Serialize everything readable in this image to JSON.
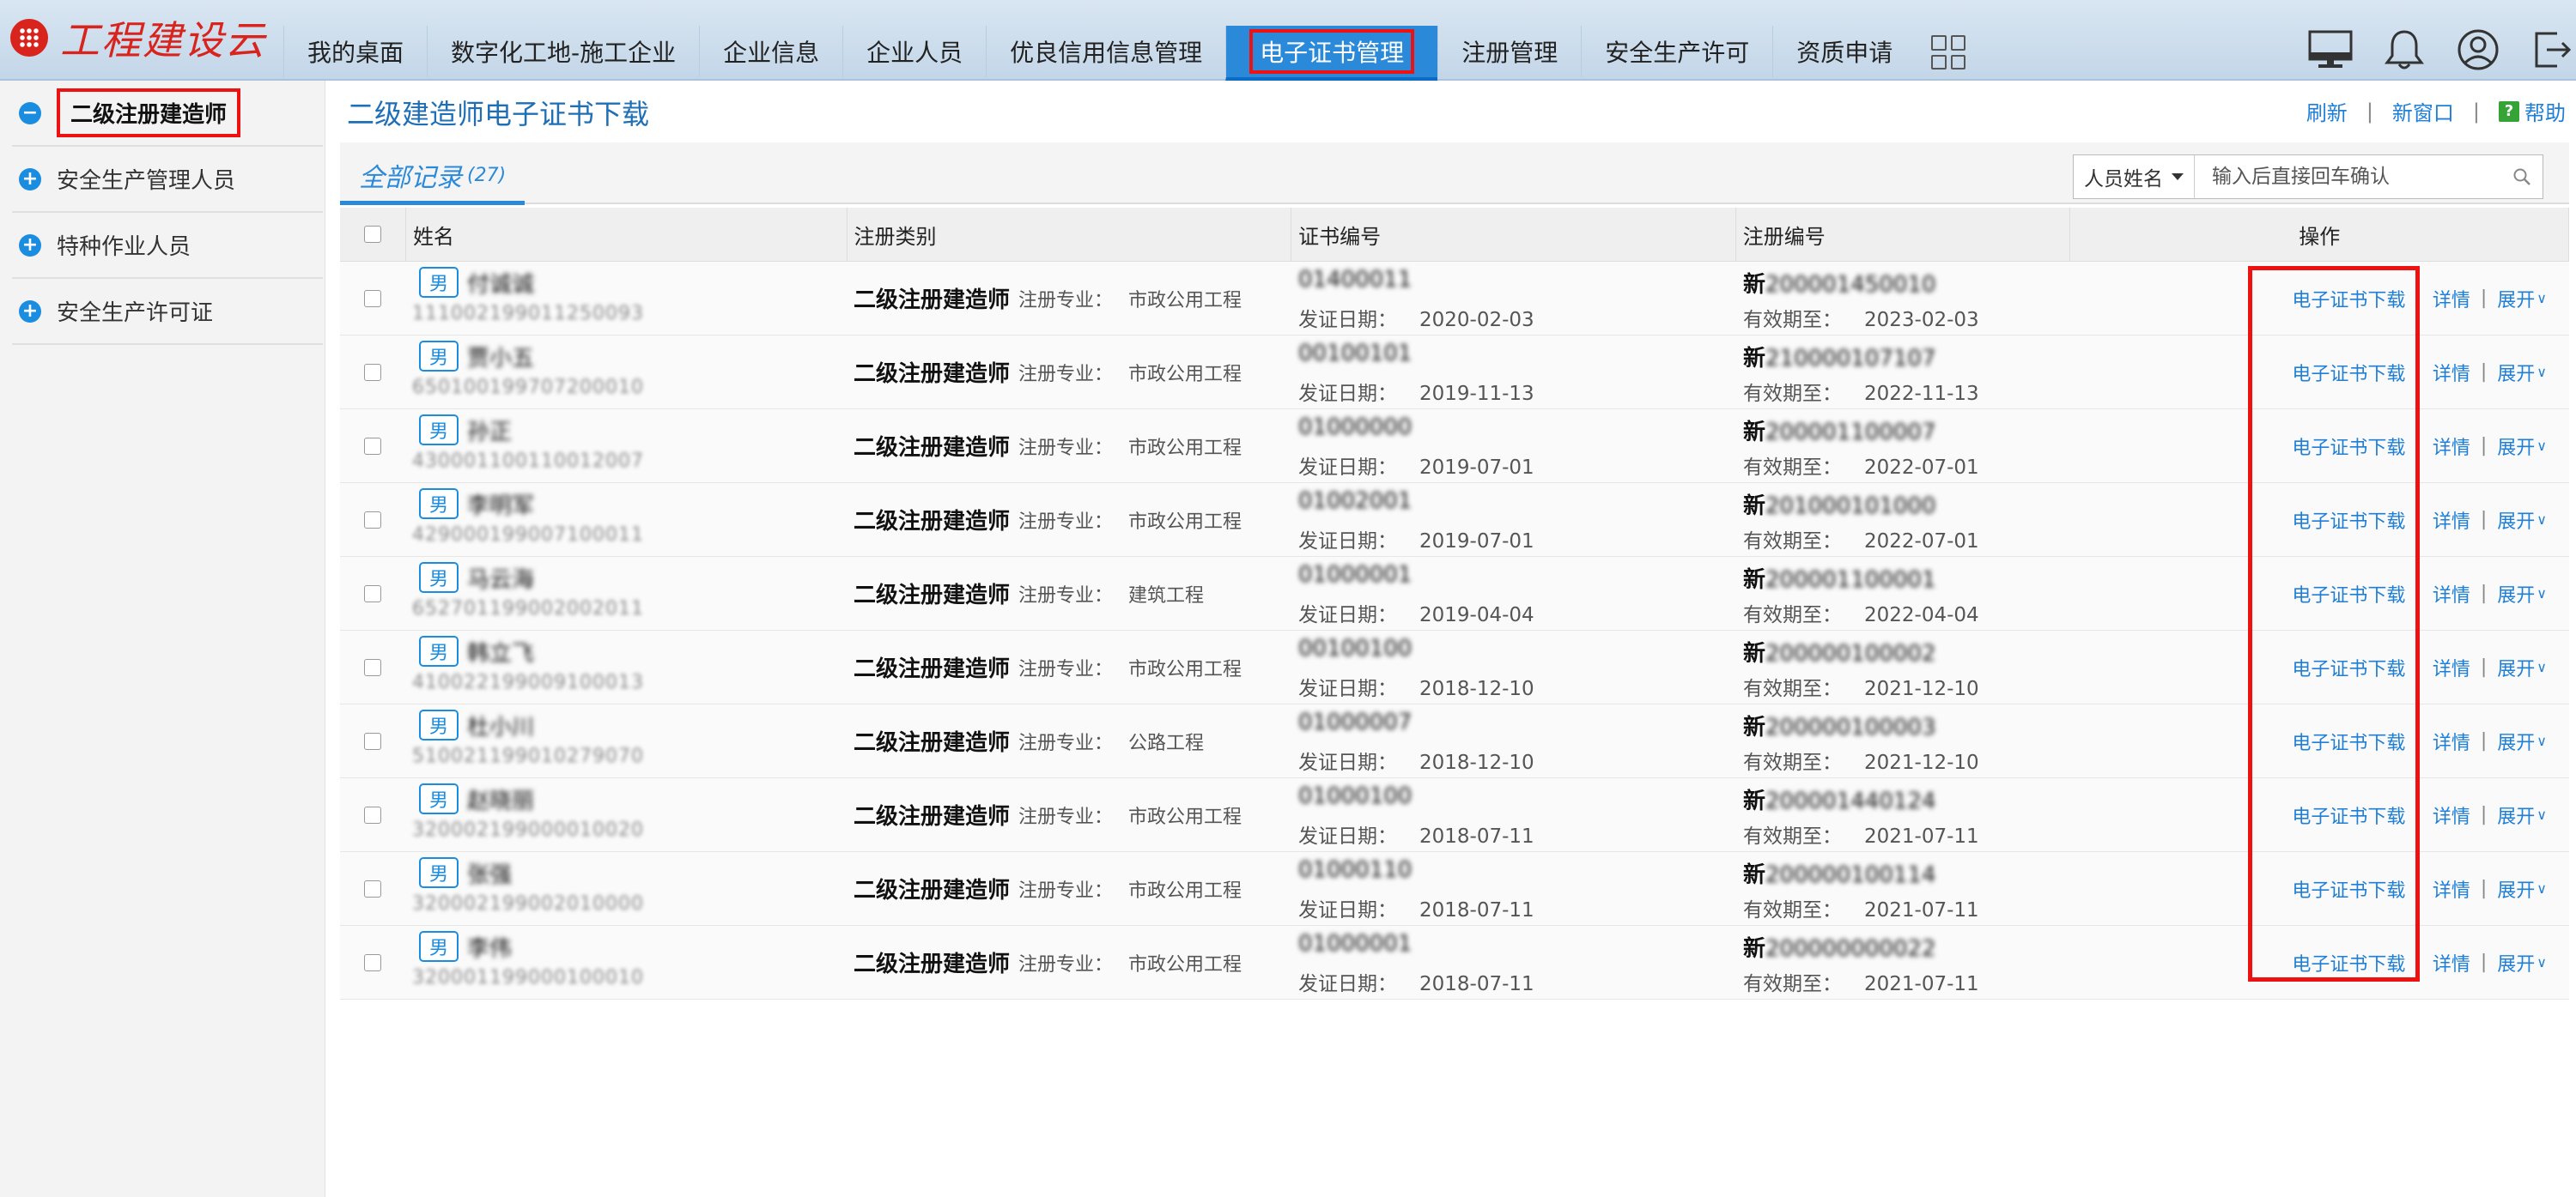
{
  "app": {
    "logo_text": "工程建设云"
  },
  "nav": {
    "items": [
      {
        "label": "我的桌面"
      },
      {
        "label": "数字化工地-施工企业"
      },
      {
        "label": "企业信息"
      },
      {
        "label": "企业人员"
      },
      {
        "label": "优良信用信息管理"
      },
      {
        "label": "电子证书管理",
        "active": true
      },
      {
        "label": "注册管理"
      },
      {
        "label": "安全生产许可"
      },
      {
        "label": "资质申请"
      }
    ],
    "icons": [
      "apps-grid-icon",
      "monitor-icon",
      "bell-icon",
      "user-icon",
      "logout-icon"
    ]
  },
  "sidebar": {
    "items": [
      {
        "label": "二级注册建造师",
        "active": true,
        "icon": "minus-circle-icon"
      },
      {
        "label": "安全生产管理人员",
        "icon": "plus-circle-icon"
      },
      {
        "label": "特种作业人员",
        "icon": "plus-circle-icon"
      },
      {
        "label": "安全生产许可证",
        "icon": "plus-circle-icon"
      }
    ]
  },
  "page": {
    "title": "二级建造师电子证书下载",
    "actions": {
      "refresh": "刷新",
      "new_window": "新窗口",
      "help": "帮助",
      "help_icon_text": "?"
    }
  },
  "tabs": {
    "all_label": "全部记录",
    "all_count": "(27)"
  },
  "search": {
    "field": "人员姓名",
    "placeholder": "输入后直接回车确认"
  },
  "table": {
    "headers": {
      "name": "姓名",
      "type": "注册类别",
      "cert_no": "证书编号",
      "reg_no": "注册编号",
      "ops": "操作"
    },
    "labels": {
      "specialty": "注册专业：",
      "issue_date": "发证日期：",
      "valid_until": "有效期至：",
      "gender": "男",
      "op_download": "电子证书下载",
      "op_detail": "详情",
      "op_expand": "展开",
      "reg_prefix": "新"
    },
    "rows": [
      {
        "name": "付诚诚",
        "id": "111002199011250093",
        "type": "二级注册建造师",
        "specialty": "市政公用工程",
        "cert": "01400011",
        "issue": "2020-02-03",
        "reg": "200001450010",
        "valid": "2023-02-03"
      },
      {
        "name": "贾小五",
        "id": "650100199707200010",
        "type": "二级注册建造师",
        "specialty": "市政公用工程",
        "cert": "00100101",
        "issue": "2019-11-13",
        "reg": "210000107107",
        "valid": "2022-11-13"
      },
      {
        "name": "孙正",
        "id": "430001100110012007",
        "type": "二级注册建造师",
        "specialty": "市政公用工程",
        "cert": "01000000",
        "issue": "2019-07-01",
        "reg": "200001100007",
        "valid": "2022-07-01"
      },
      {
        "name": "李明军",
        "id": "429000199007100011",
        "type": "二级注册建造师",
        "specialty": "市政公用工程",
        "cert": "01002001",
        "issue": "2019-07-01",
        "reg": "201000101000",
        "valid": "2022-07-01"
      },
      {
        "name": "马云海",
        "id": "652701199002002011",
        "type": "二级注册建造师",
        "specialty": "建筑工程",
        "cert": "01000001",
        "issue": "2019-04-04",
        "reg": "200001100001",
        "valid": "2022-04-04"
      },
      {
        "name": "韩立飞",
        "id": "410022199009100013",
        "type": "二级注册建造师",
        "specialty": "市政公用工程",
        "cert": "00100100",
        "issue": "2018-12-10",
        "reg": "200000100002",
        "valid": "2021-12-10"
      },
      {
        "name": "杜小川",
        "id": "510021199010279070",
        "type": "二级注册建造师",
        "specialty": "公路工程",
        "cert": "01000007",
        "issue": "2018-12-10",
        "reg": "200000100003",
        "valid": "2021-12-10"
      },
      {
        "name": "赵晓丽",
        "id": "320002199000010020",
        "type": "二级注册建造师",
        "specialty": "市政公用工程",
        "cert": "01000100",
        "issue": "2018-07-11",
        "reg": "200001440124",
        "valid": "2021-07-11"
      },
      {
        "name": "张强",
        "id": "320002199002010000",
        "type": "二级注册建造师",
        "specialty": "市政公用工程",
        "cert": "01000110",
        "issue": "2018-07-11",
        "reg": "200000100114",
        "valid": "2021-07-11"
      },
      {
        "name": "李伟",
        "id": "320001199000100010",
        "type": "二级注册建造师",
        "specialty": "市政公用工程",
        "cert": "01000001",
        "issue": "2018-07-11",
        "reg": "200000000022",
        "valid": "2021-07-11"
      }
    ]
  }
}
